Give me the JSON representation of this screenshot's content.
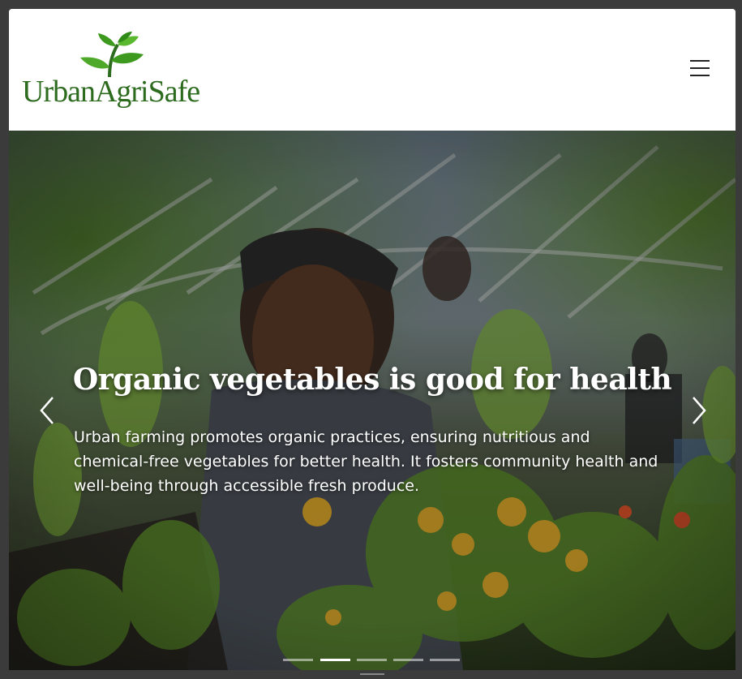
{
  "brand": {
    "name": "UrbanAgriSafe",
    "logo_icon": "sprout-leaves-icon",
    "color": "#2d6b1f"
  },
  "navbar": {
    "menu_icon": "hamburger-menu-icon"
  },
  "hero": {
    "title": "Organic vegetables is good for health",
    "text": "Urban farming promotes organic practices, ensuring nutritious and chemical-free vegetables for better health. It fosters community health and well-being through accessible fresh produce.",
    "prev_icon": "chevron-left-icon",
    "next_icon": "chevron-right-icon",
    "slide_count": 5,
    "active_slide": 2
  }
}
